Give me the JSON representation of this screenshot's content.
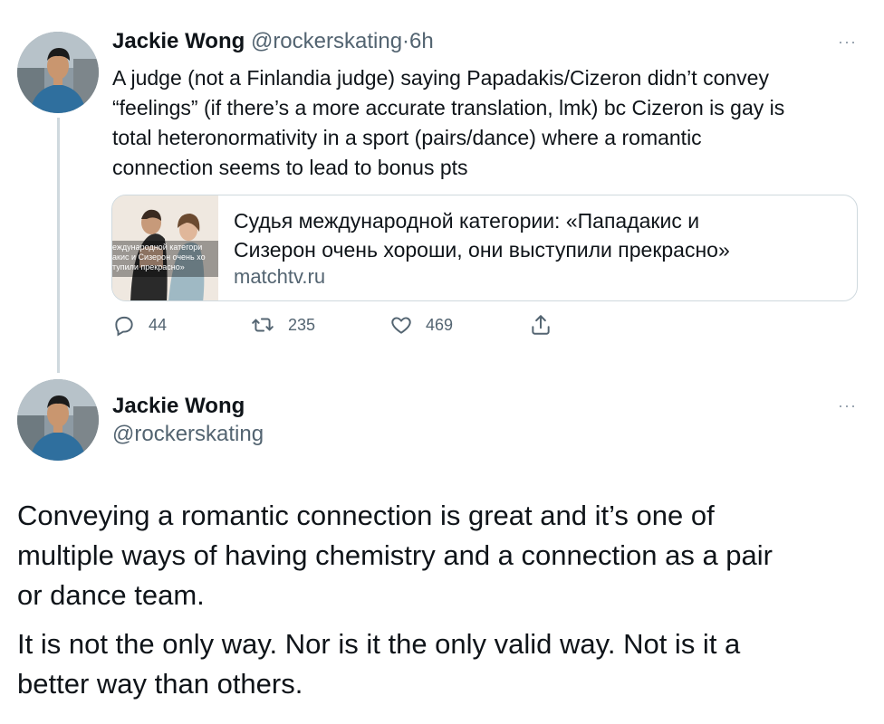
{
  "tweet1": {
    "author_name": "Jackie Wong",
    "author_handle": "@rockerskating",
    "separator": "·",
    "time": "6h",
    "more": "···",
    "text_lines": [
      "A judge (not a Finlandia judge) saying Papadakis/Cizeron didn’t convey",
      "“feelings” (if there’s a more accurate translation, lmk) bc Cizeron is gay is",
      "total heteronormativity in a sport (pairs/dance) where a romantic",
      "connection seems to lead to bonus pts"
    ],
    "card": {
      "title_lines": [
        "Судья международной категории: «Пападакис и",
        "Сизерон очень хороши, они выступили прекрасно»"
      ],
      "domain": "matchtv.ru",
      "thumb_caption_lines": [
        "еждународной категори",
        "акис и Сизерон очень хо",
        "тупили прекрасно»"
      ]
    },
    "actions": {
      "replies": "44",
      "retweets": "235",
      "likes": "469"
    }
  },
  "tweet2": {
    "author_name": "Jackie Wong",
    "author_handle": "@rockerskating",
    "more": "···",
    "paragraphs": [
      {
        "lines": [
          "Conveying a romantic connection is great and it’s one of",
          "multiple ways of having chemistry and a connection as a pair",
          "or dance team."
        ]
      },
      {
        "lines": [
          "It is not the only way. Nor is it the only valid way. Not is it a",
          "better way than others."
        ]
      }
    ]
  },
  "colors": {
    "text": "#0f1419",
    "secondary": "#536471",
    "border": "#cfd9de"
  }
}
